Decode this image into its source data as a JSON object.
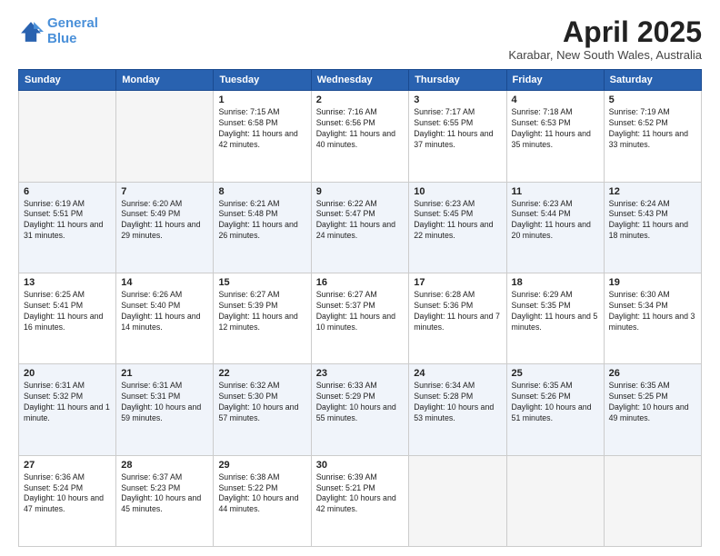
{
  "header": {
    "logo_line1": "General",
    "logo_line2": "Blue",
    "month": "April 2025",
    "location": "Karabar, New South Wales, Australia"
  },
  "days_of_week": [
    "Sunday",
    "Monday",
    "Tuesday",
    "Wednesday",
    "Thursday",
    "Friday",
    "Saturday"
  ],
  "weeks": [
    [
      {
        "day": "",
        "info": ""
      },
      {
        "day": "",
        "info": ""
      },
      {
        "day": "1",
        "info": "Sunrise: 7:15 AM\nSunset: 6:58 PM\nDaylight: 11 hours and 42 minutes."
      },
      {
        "day": "2",
        "info": "Sunrise: 7:16 AM\nSunset: 6:56 PM\nDaylight: 11 hours and 40 minutes."
      },
      {
        "day": "3",
        "info": "Sunrise: 7:17 AM\nSunset: 6:55 PM\nDaylight: 11 hours and 37 minutes."
      },
      {
        "day": "4",
        "info": "Sunrise: 7:18 AM\nSunset: 6:53 PM\nDaylight: 11 hours and 35 minutes."
      },
      {
        "day": "5",
        "info": "Sunrise: 7:19 AM\nSunset: 6:52 PM\nDaylight: 11 hours and 33 minutes."
      }
    ],
    [
      {
        "day": "6",
        "info": "Sunrise: 6:19 AM\nSunset: 5:51 PM\nDaylight: 11 hours and 31 minutes."
      },
      {
        "day": "7",
        "info": "Sunrise: 6:20 AM\nSunset: 5:49 PM\nDaylight: 11 hours and 29 minutes."
      },
      {
        "day": "8",
        "info": "Sunrise: 6:21 AM\nSunset: 5:48 PM\nDaylight: 11 hours and 26 minutes."
      },
      {
        "day": "9",
        "info": "Sunrise: 6:22 AM\nSunset: 5:47 PM\nDaylight: 11 hours and 24 minutes."
      },
      {
        "day": "10",
        "info": "Sunrise: 6:23 AM\nSunset: 5:45 PM\nDaylight: 11 hours and 22 minutes."
      },
      {
        "day": "11",
        "info": "Sunrise: 6:23 AM\nSunset: 5:44 PM\nDaylight: 11 hours and 20 minutes."
      },
      {
        "day": "12",
        "info": "Sunrise: 6:24 AM\nSunset: 5:43 PM\nDaylight: 11 hours and 18 minutes."
      }
    ],
    [
      {
        "day": "13",
        "info": "Sunrise: 6:25 AM\nSunset: 5:41 PM\nDaylight: 11 hours and 16 minutes."
      },
      {
        "day": "14",
        "info": "Sunrise: 6:26 AM\nSunset: 5:40 PM\nDaylight: 11 hours and 14 minutes."
      },
      {
        "day": "15",
        "info": "Sunrise: 6:27 AM\nSunset: 5:39 PM\nDaylight: 11 hours and 12 minutes."
      },
      {
        "day": "16",
        "info": "Sunrise: 6:27 AM\nSunset: 5:37 PM\nDaylight: 11 hours and 10 minutes."
      },
      {
        "day": "17",
        "info": "Sunrise: 6:28 AM\nSunset: 5:36 PM\nDaylight: 11 hours and 7 minutes."
      },
      {
        "day": "18",
        "info": "Sunrise: 6:29 AM\nSunset: 5:35 PM\nDaylight: 11 hours and 5 minutes."
      },
      {
        "day": "19",
        "info": "Sunrise: 6:30 AM\nSunset: 5:34 PM\nDaylight: 11 hours and 3 minutes."
      }
    ],
    [
      {
        "day": "20",
        "info": "Sunrise: 6:31 AM\nSunset: 5:32 PM\nDaylight: 11 hours and 1 minute."
      },
      {
        "day": "21",
        "info": "Sunrise: 6:31 AM\nSunset: 5:31 PM\nDaylight: 10 hours and 59 minutes."
      },
      {
        "day": "22",
        "info": "Sunrise: 6:32 AM\nSunset: 5:30 PM\nDaylight: 10 hours and 57 minutes."
      },
      {
        "day": "23",
        "info": "Sunrise: 6:33 AM\nSunset: 5:29 PM\nDaylight: 10 hours and 55 minutes."
      },
      {
        "day": "24",
        "info": "Sunrise: 6:34 AM\nSunset: 5:28 PM\nDaylight: 10 hours and 53 minutes."
      },
      {
        "day": "25",
        "info": "Sunrise: 6:35 AM\nSunset: 5:26 PM\nDaylight: 10 hours and 51 minutes."
      },
      {
        "day": "26",
        "info": "Sunrise: 6:35 AM\nSunset: 5:25 PM\nDaylight: 10 hours and 49 minutes."
      }
    ],
    [
      {
        "day": "27",
        "info": "Sunrise: 6:36 AM\nSunset: 5:24 PM\nDaylight: 10 hours and 47 minutes."
      },
      {
        "day": "28",
        "info": "Sunrise: 6:37 AM\nSunset: 5:23 PM\nDaylight: 10 hours and 45 minutes."
      },
      {
        "day": "29",
        "info": "Sunrise: 6:38 AM\nSunset: 5:22 PM\nDaylight: 10 hours and 44 minutes."
      },
      {
        "day": "30",
        "info": "Sunrise: 6:39 AM\nSunset: 5:21 PM\nDaylight: 10 hours and 42 minutes."
      },
      {
        "day": "",
        "info": ""
      },
      {
        "day": "",
        "info": ""
      },
      {
        "day": "",
        "info": ""
      }
    ]
  ]
}
